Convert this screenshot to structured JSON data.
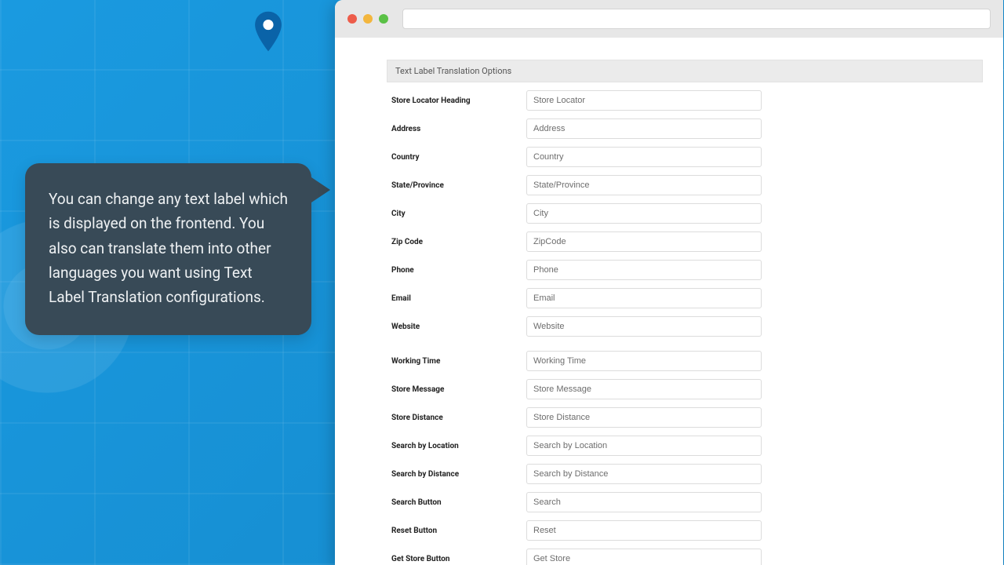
{
  "callout": {
    "text": "You can change any text label which is displayed on the frontend. You also can translate them into other languages you want using Text Label Translation configurations."
  },
  "panel_title": "Text Label Translation Options",
  "fields": [
    {
      "label": "Store Locator Heading",
      "value": "Store Locator",
      "name": "store-locator-heading"
    },
    {
      "label": "Address",
      "value": "Address",
      "name": "address"
    },
    {
      "label": "Country",
      "value": "Country",
      "name": "country"
    },
    {
      "label": "State/Province",
      "value": "State/Province",
      "name": "state-province"
    },
    {
      "label": "City",
      "value": "City",
      "name": "city"
    },
    {
      "label": "Zip Code",
      "value": "ZipCode",
      "name": "zip-code"
    },
    {
      "label": "Phone",
      "value": "Phone",
      "name": "phone"
    },
    {
      "label": "Email",
      "value": "Email",
      "name": "email"
    },
    {
      "label": "Website",
      "value": "Website",
      "name": "website"
    },
    {
      "label": "Working Time",
      "value": "Working Time",
      "name": "working-time",
      "gap": true
    },
    {
      "label": "Store Message",
      "value": "Store Message",
      "name": "store-message"
    },
    {
      "label": "Store Distance",
      "value": "Store Distance",
      "name": "store-distance"
    },
    {
      "label": "Search by Location",
      "value": "Search by Location",
      "name": "search-by-location"
    },
    {
      "label": "Search by Distance",
      "value": "Search by Distance",
      "name": "search-by-distance"
    },
    {
      "label": "Search Button",
      "value": "Search",
      "name": "search-button"
    },
    {
      "label": "Reset Button",
      "value": "Reset",
      "name": "reset-button"
    },
    {
      "label": "Get Store Button",
      "value": "Get Store",
      "name": "get-store-button"
    }
  ],
  "colors": {
    "accent_blue": "#1a9ae0",
    "callout_bg": "#384a57",
    "pin_blue": "#0a63a8"
  }
}
